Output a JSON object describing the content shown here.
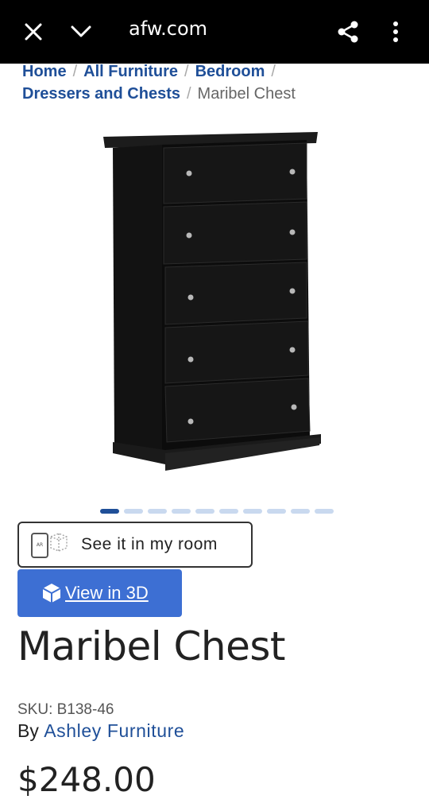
{
  "browser": {
    "url": "afw.com",
    "icons": [
      "close-icon",
      "chevron-down-icon",
      "share-icon",
      "more-vert-icon"
    ]
  },
  "breadcrumb": {
    "items": [
      "Home",
      "All Furniture",
      "Bedroom",
      "Dressers and Chests"
    ],
    "current": "Maribel Chest",
    "separator": "/"
  },
  "gallery": {
    "image_count": 10,
    "active_index": 0
  },
  "actions": {
    "see_in_room_label": "See it in my room",
    "view_3d_label": "View in 3D"
  },
  "product": {
    "title": "Maribel Chest",
    "sku": "SKU: B138-46",
    "by_label": "By",
    "brand": "Ashley Furniture",
    "price": "$248.00"
  },
  "colors": {
    "brand_blue": "#1f4f98",
    "button_blue": "#3d6fd3",
    "dot_inactive": "#c9d9ef"
  }
}
